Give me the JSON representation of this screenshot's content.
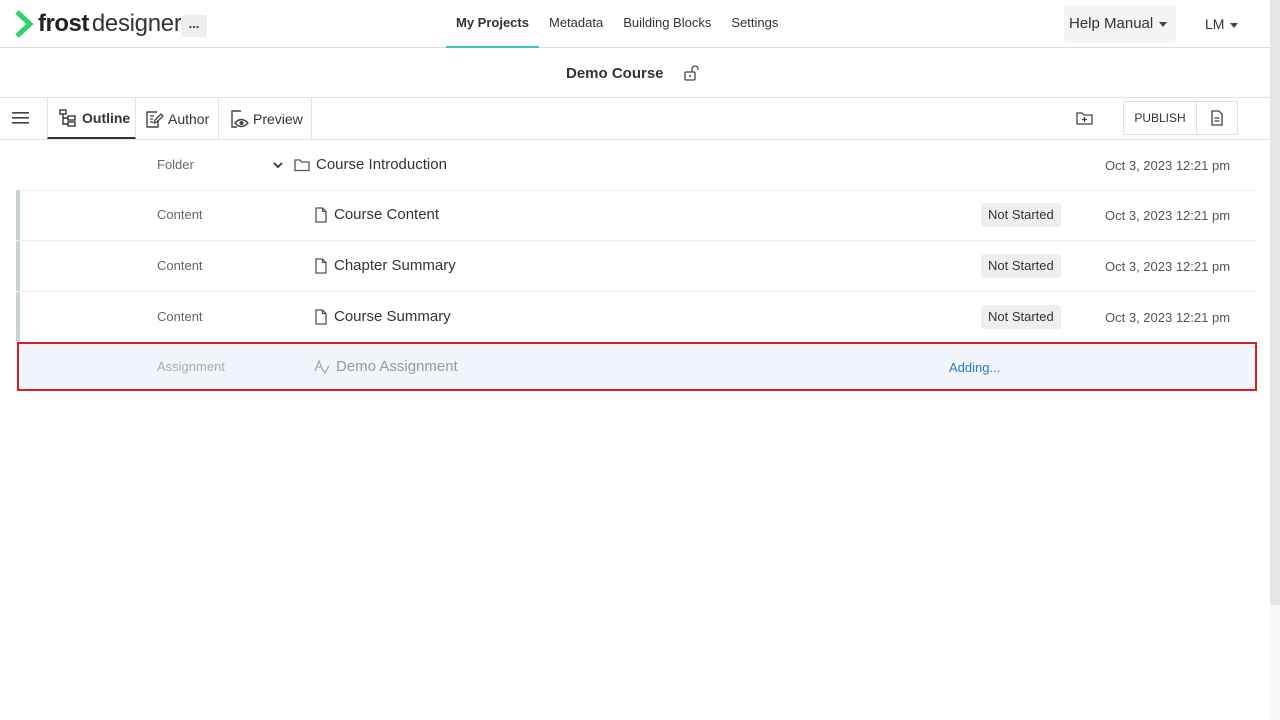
{
  "app": {
    "brand_bold": "frost",
    "brand_light": "designer",
    "more_label": "..."
  },
  "nav": {
    "items": [
      {
        "label": "My Projects",
        "active": true
      },
      {
        "label": "Metadata",
        "active": false
      },
      {
        "label": "Building Blocks",
        "active": false
      },
      {
        "label": "Settings",
        "active": false
      }
    ],
    "help_label": "Help Manual",
    "user_initials": "LM"
  },
  "course": {
    "title": "Demo Course"
  },
  "toolbar": {
    "tabs": [
      {
        "label": "Outline",
        "active": true
      },
      {
        "label": "Author",
        "active": false
      },
      {
        "label": "Preview",
        "active": false
      }
    ],
    "publish_label": "PUBLISH"
  },
  "rows": [
    {
      "type": "Folder",
      "name": "Course Introduction",
      "status": "",
      "date": "Oct 3, 2023 12:21 pm",
      "icon": "folder-icon"
    },
    {
      "type": "Content",
      "name": "Course Content",
      "status": "Not Started",
      "date": "Oct 3, 2023 12:21 pm",
      "icon": "file-icon"
    },
    {
      "type": "Content",
      "name": "Chapter Summary",
      "status": "Not Started",
      "date": "Oct 3, 2023 12:21 pm",
      "icon": "file-icon"
    },
    {
      "type": "Content",
      "name": "Course Summary",
      "status": "Not Started",
      "date": "Oct 3, 2023 12:21 pm",
      "icon": "file-icon"
    },
    {
      "type": "Assignment",
      "name": "Demo Assignment",
      "status": "Adding...",
      "date": "",
      "icon": "assignment-icon"
    }
  ],
  "colors": {
    "accent": "#40c4c8",
    "brand_green": "#2bd36b",
    "highlight_border": "#d42020",
    "adding_text": "#2f7ab8"
  }
}
